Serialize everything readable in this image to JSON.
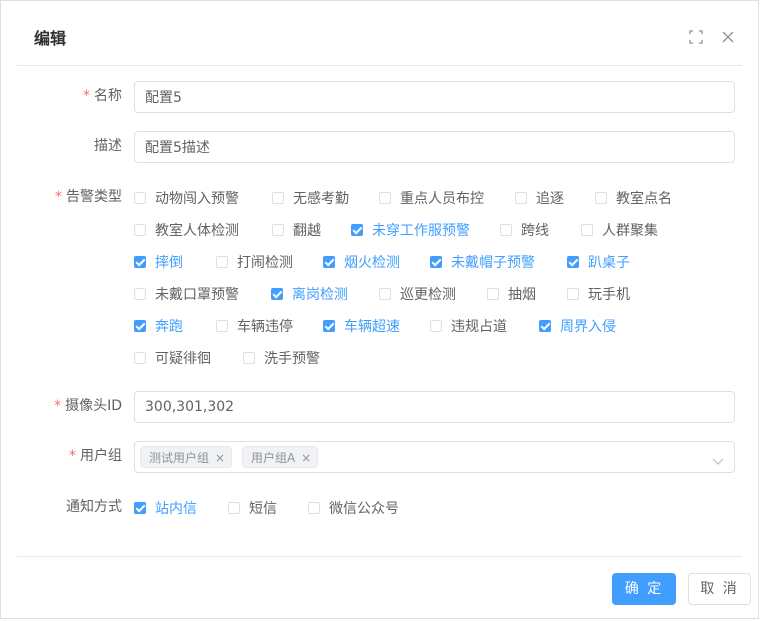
{
  "dialog": {
    "title": "编辑",
    "fullscreen_icon": "fullscreen-icon",
    "close_icon": "close-icon"
  },
  "form": {
    "name": {
      "label": "名称",
      "required": true,
      "value": "配置5"
    },
    "description": {
      "label": "描述",
      "required": false,
      "value": "配置5描述"
    },
    "alarm_types": {
      "label": "告警类型",
      "required": true,
      "options": [
        {
          "label": "动物闯入预警",
          "checked": false
        },
        {
          "label": "无感考勤",
          "checked": false
        },
        {
          "label": "重点人员布控",
          "checked": false
        },
        {
          "label": "追逐",
          "checked": false
        },
        {
          "label": "教室点名",
          "checked": false
        },
        {
          "label": "教室人体检测",
          "checked": false
        },
        {
          "label": "翻越",
          "checked": false
        },
        {
          "label": "未穿工作服预警",
          "checked": true
        },
        {
          "label": "跨线",
          "checked": false
        },
        {
          "label": "人群聚集",
          "checked": false
        },
        {
          "label": "摔倒",
          "checked": true
        },
        {
          "label": "打闹检测",
          "checked": false
        },
        {
          "label": "烟火检测",
          "checked": true
        },
        {
          "label": "未戴帽子预警",
          "checked": true
        },
        {
          "label": "趴桌子",
          "checked": true
        },
        {
          "label": "未戴口罩预警",
          "checked": false
        },
        {
          "label": "离岗检测",
          "checked": true
        },
        {
          "label": "巡更检测",
          "checked": false
        },
        {
          "label": "抽烟",
          "checked": false
        },
        {
          "label": "玩手机",
          "checked": false
        },
        {
          "label": "奔跑",
          "checked": true
        },
        {
          "label": "车辆违停",
          "checked": false
        },
        {
          "label": "车辆超速",
          "checked": true
        },
        {
          "label": "违规占道",
          "checked": false
        },
        {
          "label": "周界入侵",
          "checked": true
        },
        {
          "label": "可疑徘徊",
          "checked": false
        },
        {
          "label": "洗手预警",
          "checked": false
        }
      ]
    },
    "camera_id": {
      "label": "摄像头ID",
      "required": true,
      "value": "300,301,302"
    },
    "user_group": {
      "label": "用户组",
      "required": true,
      "tags": [
        "测试用户组",
        "用户组A"
      ],
      "tag_close": "×",
      "dropdown_icon": "chevron-down-icon"
    },
    "notify": {
      "label": "通知方式",
      "required": false,
      "options": [
        {
          "label": "站内信",
          "checked": true
        },
        {
          "label": "短信",
          "checked": false
        },
        {
          "label": "微信公众号",
          "checked": false
        }
      ]
    }
  },
  "footer": {
    "confirm_label": "确 定",
    "cancel_label": "取 消"
  },
  "colors": {
    "primary": "#409eff",
    "required": "#f56c6c",
    "border": "#dcdfe6",
    "text": "#606266"
  }
}
